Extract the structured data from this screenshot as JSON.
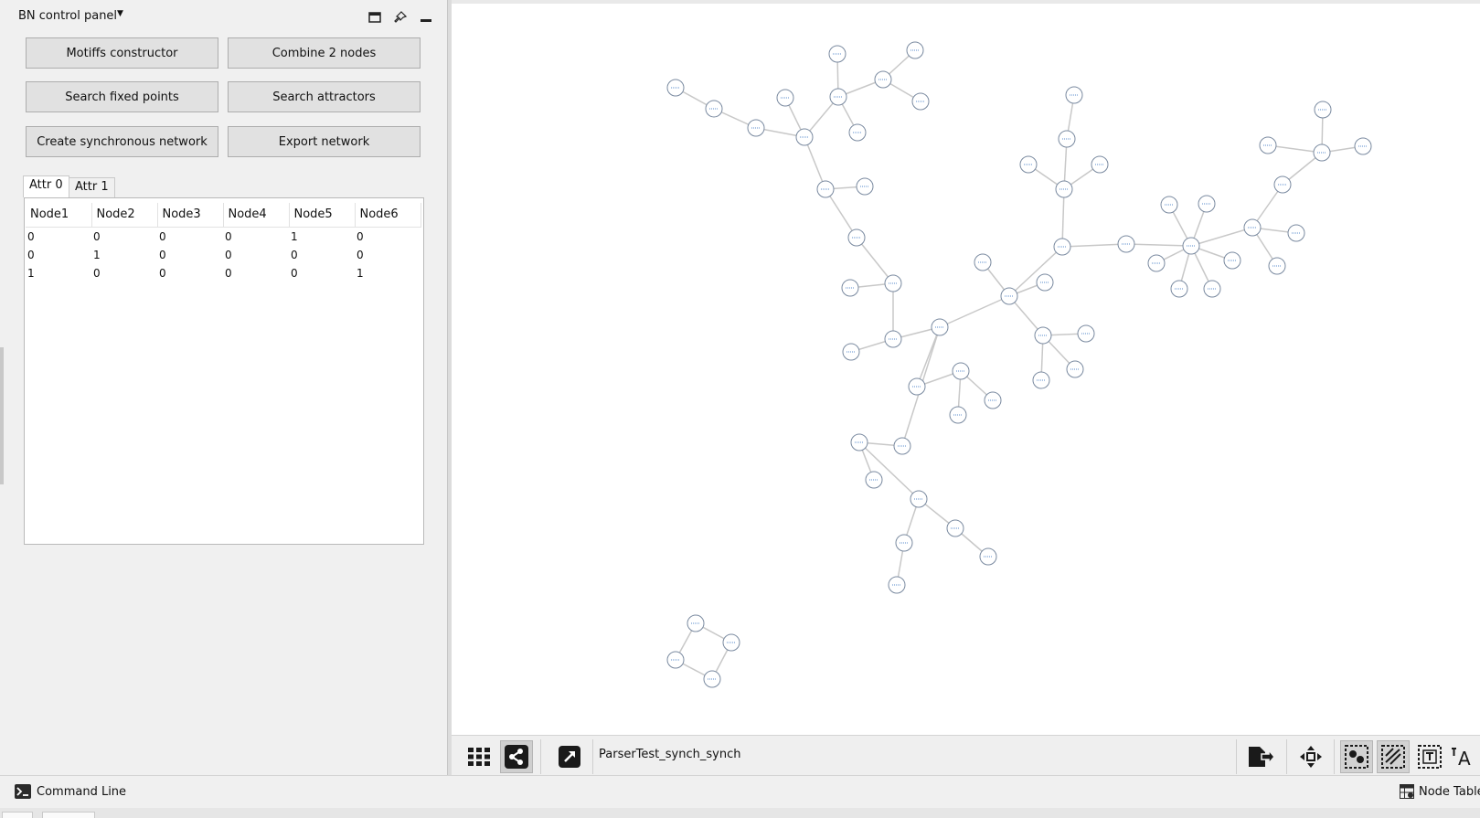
{
  "panel": {
    "title": "BN control panel",
    "buttons": {
      "motifs": "Motiffs constructor",
      "combine": "Combine 2 nodes",
      "fixed_points": "Search fixed points",
      "attractors": "Search attractors",
      "sync_network": "Create synchronous network",
      "export": "Export network"
    },
    "tabs": [
      "Attr 0",
      "Attr 1"
    ],
    "active_tab": "Attr 0",
    "table": {
      "headers": [
        "Node1",
        "Node2",
        "Node3",
        "Node4",
        "Node5",
        "Node6"
      ],
      "rows": [
        [
          "0",
          "0",
          "0",
          "0",
          "1",
          "0"
        ],
        [
          "0",
          "1",
          "0",
          "0",
          "0",
          "0"
        ],
        [
          "1",
          "0",
          "0",
          "0",
          "0",
          "1"
        ]
      ]
    }
  },
  "toolbar": {
    "network_title": "ParserTest_synch_synch"
  },
  "statusbar": {
    "command_line": "Command Line",
    "node_table": "Node Table"
  },
  "icons": [
    "window-icon",
    "pin-icon",
    "minimize-icon",
    "grid-view-icon",
    "share-network-icon",
    "open-external-icon",
    "export-icon",
    "move-icon",
    "select-nodes-icon",
    "select-edges-icon",
    "annotation-icon",
    "text-size-icon",
    "terminal-icon",
    "table-icon"
  ],
  "colors": {
    "node_stroke": "#7a8aa0",
    "node_label": "#5b8ccc",
    "edge": "#c8c8c8",
    "button_bg": "#e1e1e1"
  }
}
